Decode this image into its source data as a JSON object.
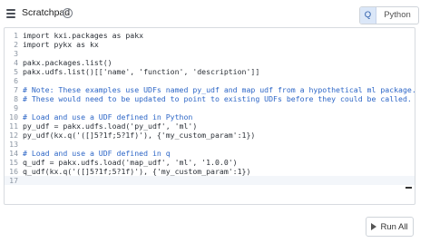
{
  "header": {
    "title": "Scratchpad",
    "help_glyph": "?",
    "languages": [
      "Q",
      "Python"
    ],
    "selected_language": "Q"
  },
  "editor": {
    "lines": [
      {
        "n": "1",
        "text": "import kxi.packages as pakx",
        "type": "code"
      },
      {
        "n": "2",
        "text": "import pykx as kx",
        "type": "code"
      },
      {
        "n": "3",
        "text": "",
        "type": "code"
      },
      {
        "n": "4",
        "text": "pakx.packages.list()",
        "type": "code"
      },
      {
        "n": "5",
        "text": "pakx.udfs.list()[['name', 'function', 'description']]",
        "type": "code"
      },
      {
        "n": "6",
        "text": "",
        "type": "code"
      },
      {
        "n": "7",
        "text": "# Note: These examples use UDFs named py_udf and map udf from a hypothetical ml package.",
        "type": "comment"
      },
      {
        "n": "8",
        "text": "# These would need to be updated to point to existing UDFs before they could be called.",
        "type": "comment"
      },
      {
        "n": "9",
        "text": "",
        "type": "code"
      },
      {
        "n": "10",
        "text": "# Load and use a UDF defined in Python",
        "type": "comment"
      },
      {
        "n": "11",
        "text": "py_udf = pakx.udfs.load('py_udf', 'ml')",
        "type": "code"
      },
      {
        "n": "12",
        "text": "py_udf(kx.q('([]5?1f;5?1f)'), {'my_custom_param':1})",
        "type": "code"
      },
      {
        "n": "13",
        "text": "",
        "type": "code"
      },
      {
        "n": "14",
        "text": "# Load and use a UDF defined in q",
        "type": "comment"
      },
      {
        "n": "15",
        "text": "q_udf = pakx.udfs.load('map_udf', 'ml', '1.0.0')",
        "type": "code"
      },
      {
        "n": "16",
        "text": "q_udf(kx.q('([]5?1f;5?1f)'), {'my_custom_param':1})",
        "type": "code"
      },
      {
        "n": "17",
        "text": "",
        "type": "code"
      }
    ]
  },
  "footer": {
    "run_all_label": "Run All"
  }
}
